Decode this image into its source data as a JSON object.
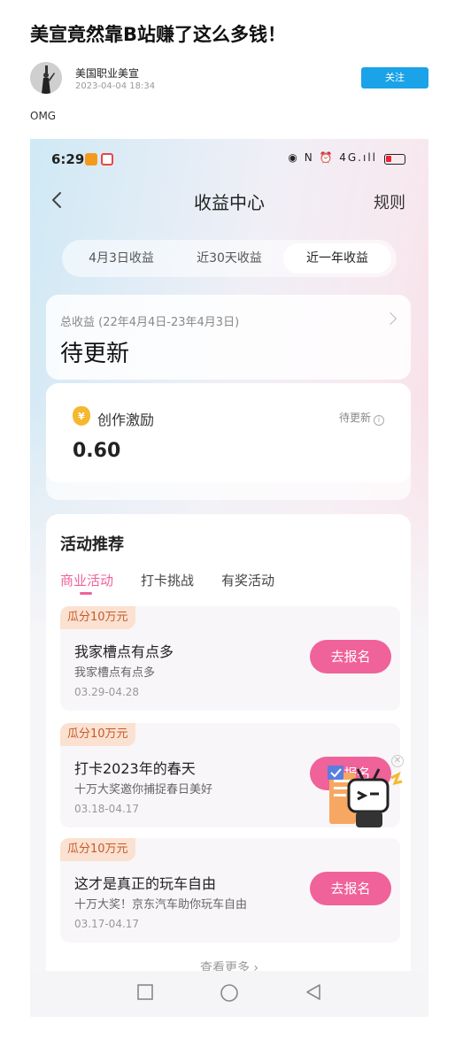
{
  "post": {
    "title": "美宣竟然靠B站赚了这么多钱！",
    "author": "美国职业美宣",
    "date": "2023-04-04 18:34",
    "follow_label": "关注",
    "body_text": "OMG"
  },
  "screen": {
    "status_time": "6:29",
    "status_icons_text": "◉ N ⏰ 4G.ıll",
    "title": "收益中心",
    "rules_label": "规则",
    "period_tabs": [
      "4月3日收益",
      "近30天收益",
      "近一年收益"
    ],
    "active_period_tab": 2,
    "total": {
      "label": "总收益 (22年4月4日-23年4月3日)",
      "value": "待更新"
    },
    "incentive": {
      "icon_text": "¥",
      "label": "创作激励",
      "status": "待更新",
      "info_icon": "ⓘ",
      "value": "0.60"
    },
    "activities": {
      "title": "活动推荐",
      "tabs": [
        "商业活动",
        "打卡挑战",
        "有奖活动"
      ],
      "active_tab": 0,
      "events": [
        {
          "tag": "瓜分10万元",
          "name": "我家槽点有点多",
          "desc": "我家槽点有点多",
          "date": "03.29-04.28",
          "button": "去报名"
        },
        {
          "tag": "瓜分10万元",
          "name": "打卡2023年的春天",
          "desc": "十万大奖邀你捕捉春日美好",
          "date": "03.18-04.17",
          "button": "去报名"
        },
        {
          "tag": "瓜分10万元",
          "name": "这才是真正的玩车自由",
          "desc": "十万大奖！京东汽车助你玩车自由",
          "date": "03.17-04.17",
          "button": "去报名"
        }
      ],
      "more_label": "查看更多 ›"
    },
    "float_close": "✕"
  },
  "colors": {
    "accent_pink": "#f0629a",
    "follow_blue": "#1aa3e8",
    "tag_bg": "#fbe1d1",
    "tag_text": "#c45a2a"
  }
}
